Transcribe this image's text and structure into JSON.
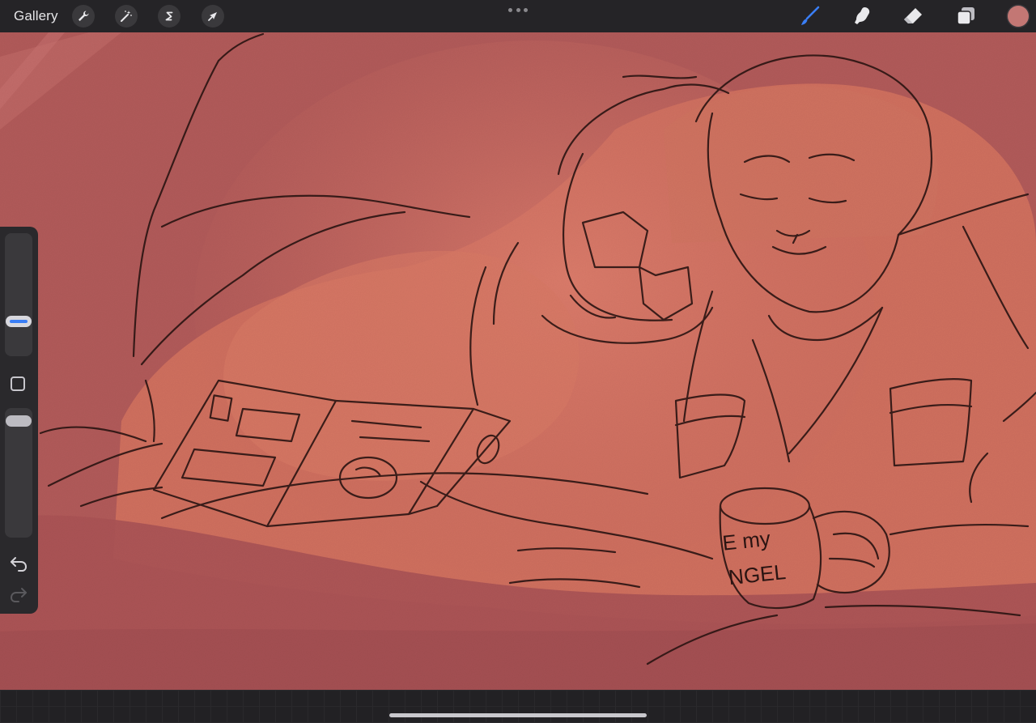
{
  "toolbar": {
    "gallery_label": "Gallery",
    "left_tools": [
      {
        "name": "actions",
        "icon": "wrench-icon"
      },
      {
        "name": "adjustments",
        "icon": "magic-wand-icon"
      },
      {
        "name": "selection",
        "icon": "selection-s-icon"
      },
      {
        "name": "transform",
        "icon": "arrow-cursor-icon"
      }
    ],
    "center_icon": "more-dots-icon",
    "right_tools": [
      {
        "name": "brush",
        "icon": "brush-icon",
        "active": true
      },
      {
        "name": "smudge",
        "icon": "smudge-finger-icon",
        "active": false
      },
      {
        "name": "eraser",
        "icon": "eraser-icon",
        "active": false
      },
      {
        "name": "layers",
        "icon": "layers-icon",
        "active": false
      }
    ],
    "current_color": "#c37774",
    "active_tool_color": "#3a7ef5"
  },
  "sidebar": {
    "size_slider_icon": "size-slider",
    "modify_icon": "square-modify-icon",
    "opacity_slider_icon": "opacity-slider",
    "undo_icon": "undo-arrow-icon",
    "redo_icon": "redo-arrow-icon"
  },
  "canvas": {
    "mug_text_line1": "E my",
    "mug_text_line2": "NGEL",
    "background_color": "#b55d5b"
  }
}
